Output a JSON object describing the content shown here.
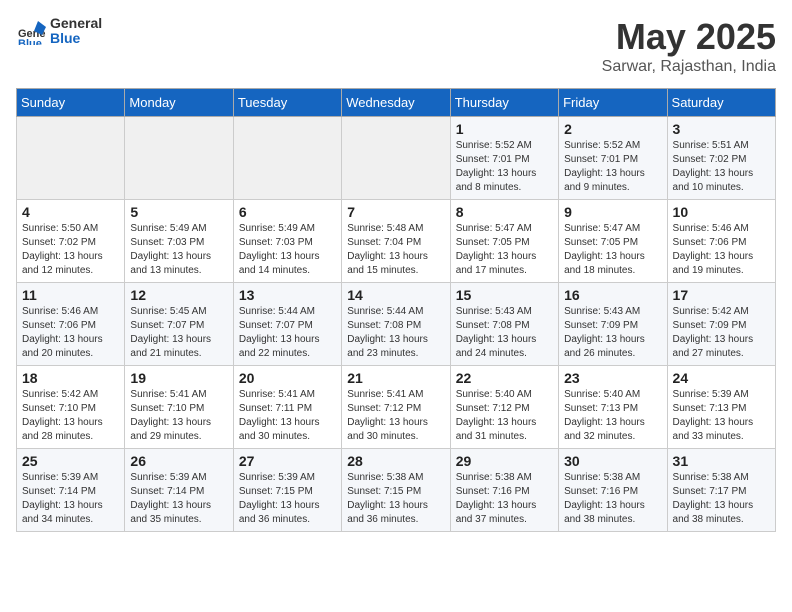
{
  "header": {
    "logo_general": "General",
    "logo_blue": "Blue",
    "title": "May 2025",
    "subtitle": "Sarwar, Rajasthan, India"
  },
  "weekdays": [
    "Sunday",
    "Monday",
    "Tuesday",
    "Wednesday",
    "Thursday",
    "Friday",
    "Saturday"
  ],
  "weeks": [
    [
      {
        "day": "",
        "info": ""
      },
      {
        "day": "",
        "info": ""
      },
      {
        "day": "",
        "info": ""
      },
      {
        "day": "",
        "info": ""
      },
      {
        "day": "1",
        "info": "Sunrise: 5:52 AM\nSunset: 7:01 PM\nDaylight: 13 hours\nand 8 minutes."
      },
      {
        "day": "2",
        "info": "Sunrise: 5:52 AM\nSunset: 7:01 PM\nDaylight: 13 hours\nand 9 minutes."
      },
      {
        "day": "3",
        "info": "Sunrise: 5:51 AM\nSunset: 7:02 PM\nDaylight: 13 hours\nand 10 minutes."
      }
    ],
    [
      {
        "day": "4",
        "info": "Sunrise: 5:50 AM\nSunset: 7:02 PM\nDaylight: 13 hours\nand 12 minutes."
      },
      {
        "day": "5",
        "info": "Sunrise: 5:49 AM\nSunset: 7:03 PM\nDaylight: 13 hours\nand 13 minutes."
      },
      {
        "day": "6",
        "info": "Sunrise: 5:49 AM\nSunset: 7:03 PM\nDaylight: 13 hours\nand 14 minutes."
      },
      {
        "day": "7",
        "info": "Sunrise: 5:48 AM\nSunset: 7:04 PM\nDaylight: 13 hours\nand 15 minutes."
      },
      {
        "day": "8",
        "info": "Sunrise: 5:47 AM\nSunset: 7:05 PM\nDaylight: 13 hours\nand 17 minutes."
      },
      {
        "day": "9",
        "info": "Sunrise: 5:47 AM\nSunset: 7:05 PM\nDaylight: 13 hours\nand 18 minutes."
      },
      {
        "day": "10",
        "info": "Sunrise: 5:46 AM\nSunset: 7:06 PM\nDaylight: 13 hours\nand 19 minutes."
      }
    ],
    [
      {
        "day": "11",
        "info": "Sunrise: 5:46 AM\nSunset: 7:06 PM\nDaylight: 13 hours\nand 20 minutes."
      },
      {
        "day": "12",
        "info": "Sunrise: 5:45 AM\nSunset: 7:07 PM\nDaylight: 13 hours\nand 21 minutes."
      },
      {
        "day": "13",
        "info": "Sunrise: 5:44 AM\nSunset: 7:07 PM\nDaylight: 13 hours\nand 22 minutes."
      },
      {
        "day": "14",
        "info": "Sunrise: 5:44 AM\nSunset: 7:08 PM\nDaylight: 13 hours\nand 23 minutes."
      },
      {
        "day": "15",
        "info": "Sunrise: 5:43 AM\nSunset: 7:08 PM\nDaylight: 13 hours\nand 24 minutes."
      },
      {
        "day": "16",
        "info": "Sunrise: 5:43 AM\nSunset: 7:09 PM\nDaylight: 13 hours\nand 26 minutes."
      },
      {
        "day": "17",
        "info": "Sunrise: 5:42 AM\nSunset: 7:09 PM\nDaylight: 13 hours\nand 27 minutes."
      }
    ],
    [
      {
        "day": "18",
        "info": "Sunrise: 5:42 AM\nSunset: 7:10 PM\nDaylight: 13 hours\nand 28 minutes."
      },
      {
        "day": "19",
        "info": "Sunrise: 5:41 AM\nSunset: 7:10 PM\nDaylight: 13 hours\nand 29 minutes."
      },
      {
        "day": "20",
        "info": "Sunrise: 5:41 AM\nSunset: 7:11 PM\nDaylight: 13 hours\nand 30 minutes."
      },
      {
        "day": "21",
        "info": "Sunrise: 5:41 AM\nSunset: 7:12 PM\nDaylight: 13 hours\nand 30 minutes."
      },
      {
        "day": "22",
        "info": "Sunrise: 5:40 AM\nSunset: 7:12 PM\nDaylight: 13 hours\nand 31 minutes."
      },
      {
        "day": "23",
        "info": "Sunrise: 5:40 AM\nSunset: 7:13 PM\nDaylight: 13 hours\nand 32 minutes."
      },
      {
        "day": "24",
        "info": "Sunrise: 5:39 AM\nSunset: 7:13 PM\nDaylight: 13 hours\nand 33 minutes."
      }
    ],
    [
      {
        "day": "25",
        "info": "Sunrise: 5:39 AM\nSunset: 7:14 PM\nDaylight: 13 hours\nand 34 minutes."
      },
      {
        "day": "26",
        "info": "Sunrise: 5:39 AM\nSunset: 7:14 PM\nDaylight: 13 hours\nand 35 minutes."
      },
      {
        "day": "27",
        "info": "Sunrise: 5:39 AM\nSunset: 7:15 PM\nDaylight: 13 hours\nand 36 minutes."
      },
      {
        "day": "28",
        "info": "Sunrise: 5:38 AM\nSunset: 7:15 PM\nDaylight: 13 hours\nand 36 minutes."
      },
      {
        "day": "29",
        "info": "Sunrise: 5:38 AM\nSunset: 7:16 PM\nDaylight: 13 hours\nand 37 minutes."
      },
      {
        "day": "30",
        "info": "Sunrise: 5:38 AM\nSunset: 7:16 PM\nDaylight: 13 hours\nand 38 minutes."
      },
      {
        "day": "31",
        "info": "Sunrise: 5:38 AM\nSunset: 7:17 PM\nDaylight: 13 hours\nand 38 minutes."
      }
    ]
  ]
}
